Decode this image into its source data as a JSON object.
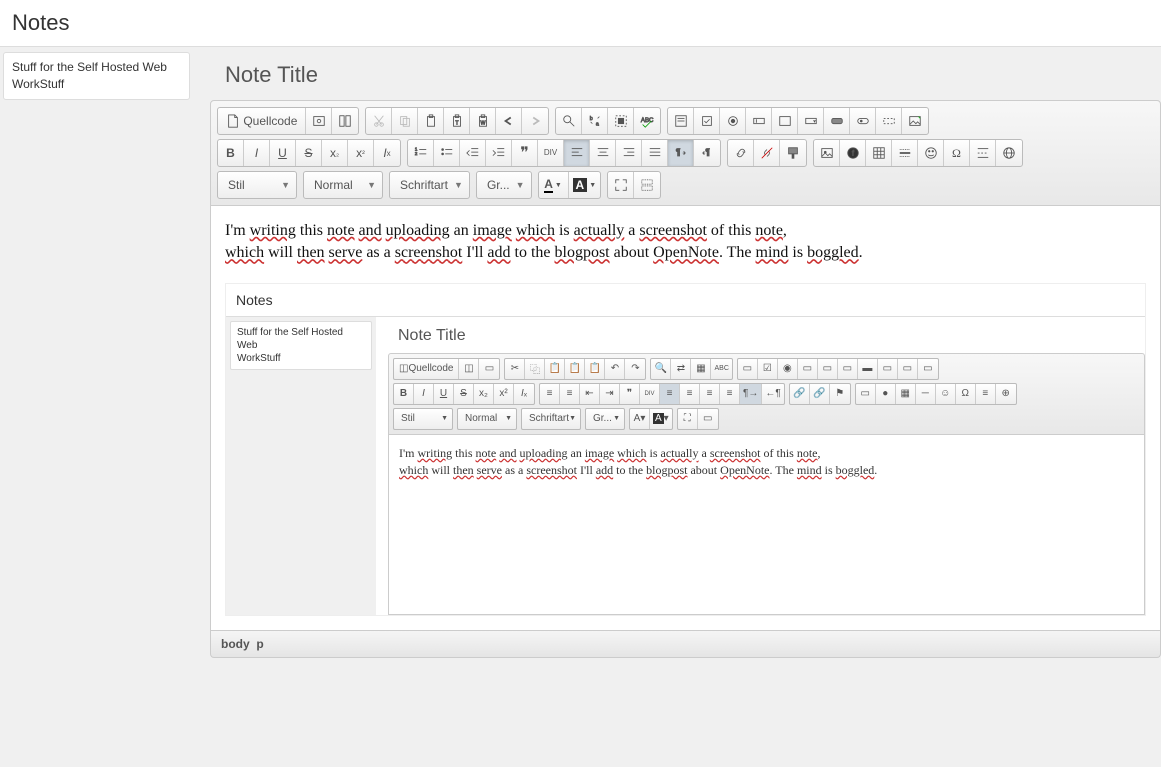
{
  "app_title": "Notes",
  "sidebar": {
    "items": [
      {
        "label": "Stuff for the Self Hosted Web"
      },
      {
        "label": "WorkStuff"
      }
    ]
  },
  "note": {
    "title": "Note Title",
    "body_line1_a": "I'm ",
    "body_line1_b": "writing",
    "body_line1_c": " this ",
    "body_line1_d": "note",
    "body_line1_e": " ",
    "body_line1_f": "and",
    "body_line1_g": " ",
    "body_line1_h": "uploading",
    "body_line1_i": " an ",
    "body_line1_j": "image",
    "body_line1_k": " ",
    "body_line1_l": "which",
    "body_line1_m": " is ",
    "body_line1_n": "actually",
    "body_line1_o": " a ",
    "body_line1_p": "screenshot",
    "body_line1_q": " of this ",
    "body_line1_r": "note",
    "body_line1_s": ",",
    "body_line2_a": "which",
    "body_line2_b": " will ",
    "body_line2_c": "then",
    "body_line2_d": " ",
    "body_line2_e": "serve",
    "body_line2_f": " as a ",
    "body_line2_g": "screenshot",
    "body_line2_h": " I'll ",
    "body_line2_i": "add",
    "body_line2_j": " to the ",
    "body_line2_k": "blogpost",
    "body_line2_l": " about ",
    "body_line2_m": "OpenNote",
    "body_line2_n": ". The ",
    "body_line2_o": "mind",
    "body_line2_p": " is ",
    "body_line2_q": "boggled",
    "body_line2_r": "."
  },
  "toolbar": {
    "source_label": "Quellcode",
    "style_label": "Stil",
    "format_label": "Normal",
    "font_label": "Schriftart",
    "size_label": "Gr...",
    "text_color_label": "A",
    "bg_color_label": "A",
    "div_label": "DIV"
  },
  "statusbar": {
    "path_body": "body",
    "path_p": "p"
  },
  "nested": {
    "app_title": "Notes",
    "sidebar_items": [
      {
        "label": "Stuff for the Self Hosted Web"
      },
      {
        "label": "WorkStuff"
      }
    ],
    "note_title": "Note Title",
    "toolbar": {
      "source_label": "Quellcode",
      "style_label": "Stil",
      "format_label": "Normal",
      "font_label": "Schriftart",
      "size_label": "Gr...",
      "text_color_label": "A",
      "bg_color_label": "A"
    }
  }
}
